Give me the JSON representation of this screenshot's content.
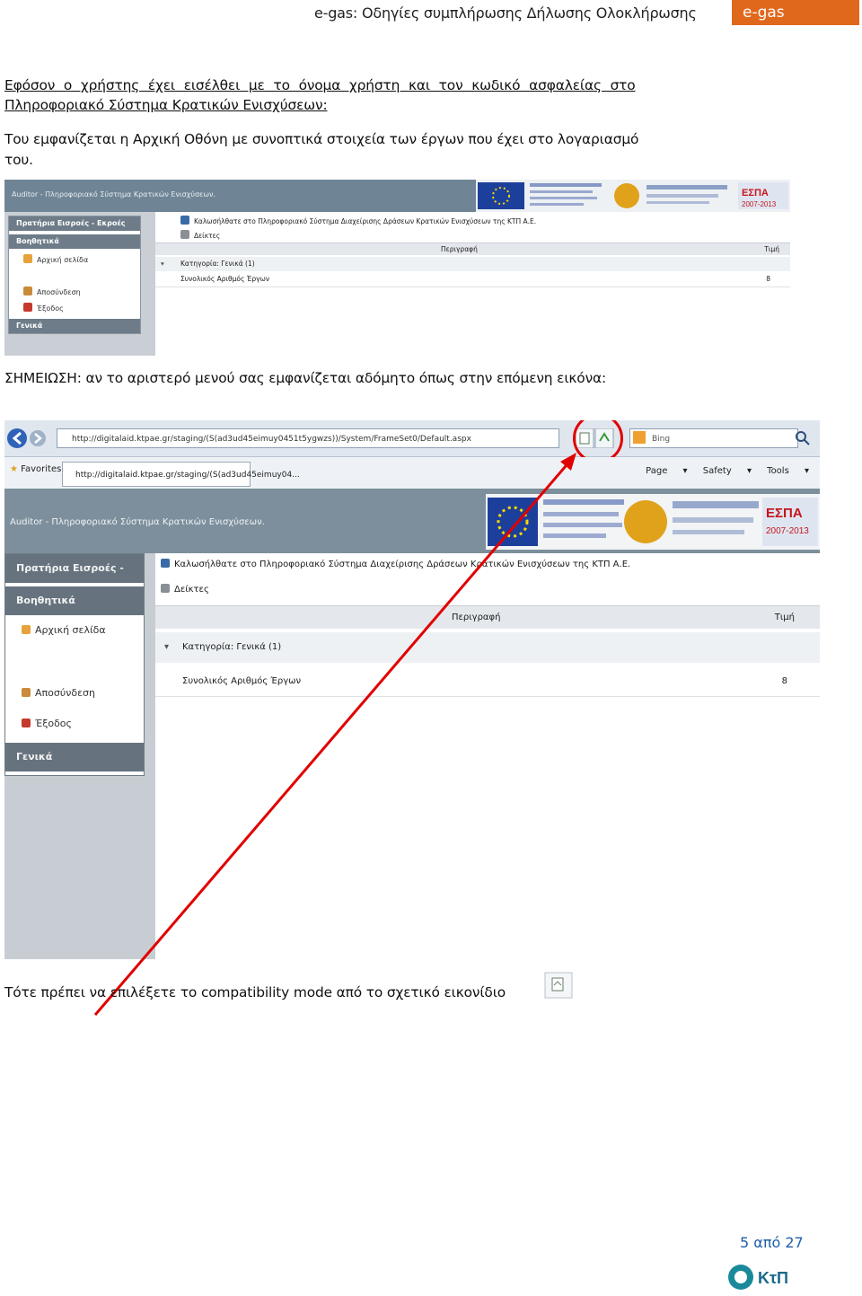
{
  "header": {
    "title": "e-gas: Οδηγίες συμπλήρωσης Δήλωσης Ολοκλήρωσης",
    "badge": "e-gas"
  },
  "intro": {
    "line1": "Εφόσον ο χρήστης έχει εισέλθει με το όνομα χρήστη και τον κωδικό ασφαλείας στο",
    "line2": "Πληροφοριακό Σύστημα Κρατικών Ενισχύσεων:",
    "line3": "Του εμφανίζεται η Αρχική Οθόνη με συνοπτικά στοιχεία των έργων που έχει στο λογαριασμό",
    "line4": "του."
  },
  "screenshot1": {
    "app_title": "Auditor - Πληροφοριακό Σύστημα Κρατικών Ενισχύσεων.",
    "menu": {
      "section1": "Πρατήρια Εισροές - Εκροές",
      "section2": "Βοηθητικά",
      "item_home": "Αρχική σελίδα",
      "item_logout": "Αποσύνδεση",
      "item_exit": "Έξοδος",
      "section3": "Γενικά"
    },
    "welcome": "Καλωσήλθατε στο Πληροφοριακό Σύστημα Διαχείρισης Δράσεων Κρατικών Ενισχύσεων της ΚΤΠ Α.Ε.",
    "indexes": "Δείκτες",
    "col_description": "Περιγραφή",
    "col_value": "Τιμή",
    "category": "Κατηγορία: Γενικά (1)",
    "row_label": "Συνολικός Αριθμός Έργων",
    "row_value": "8"
  },
  "note": "ΣΗΜΕΙΩΣΗ: αν το αριστερό μενού σας εμφανίζεται αδόμητο όπως στην επόμενη εικόνα:",
  "screenshot2": {
    "url": "http://digitalaid.ktpae.gr/staging/(S(ad3ud45eimuy0451t5ygwzs))/System/FrameSet0/Default.aspx",
    "search_engine": "Bing",
    "favorites": "Favorites",
    "tab_url": "http://digitalaid.ktpae.gr/staging/(S(ad3ud45eimuy04...",
    "tools": [
      "Page ▾",
      "Safety ▾",
      "Tools ▾"
    ],
    "app_title": "Auditor - Πληροφοριακό Σύστημα Κρατικών Ενισχύσεων.",
    "menu": {
      "section1": "Πρατήρια Εισροές - Εκροές",
      "section2": "Βοηθητικά",
      "item_home": "Αρχική σελίδα",
      "item_logout": "Αποσύνδεση",
      "item_exit": "Έξοδος",
      "section3": "Γενικά"
    },
    "welcome": "Καλωσήλθατε στο Πληροφοριακό Σύστημα Διαχείρισης Δράσεων Κρατικών Ενισχύσεων της ΚΤΠ Α.Ε.",
    "indexes": "Δείκτες",
    "col_description": "Περιγραφή",
    "col_value": "Τιμή",
    "category": "Κατηγορία: Γενικά (1)",
    "row_label": "Συνολικός Αριθμός Έργων",
    "row_value": "8"
  },
  "bottom_text": "Τότε πρέπει να επιλέξετε το compatibility mode από το σχετικό εικονίδιο",
  "footer": {
    "page_number": "5 από 27",
    "logo_text": "ΚτΠ"
  },
  "colors": {
    "badge": "#e0681c",
    "annotation": "#e10000",
    "page_number": "#1f5ea8"
  }
}
